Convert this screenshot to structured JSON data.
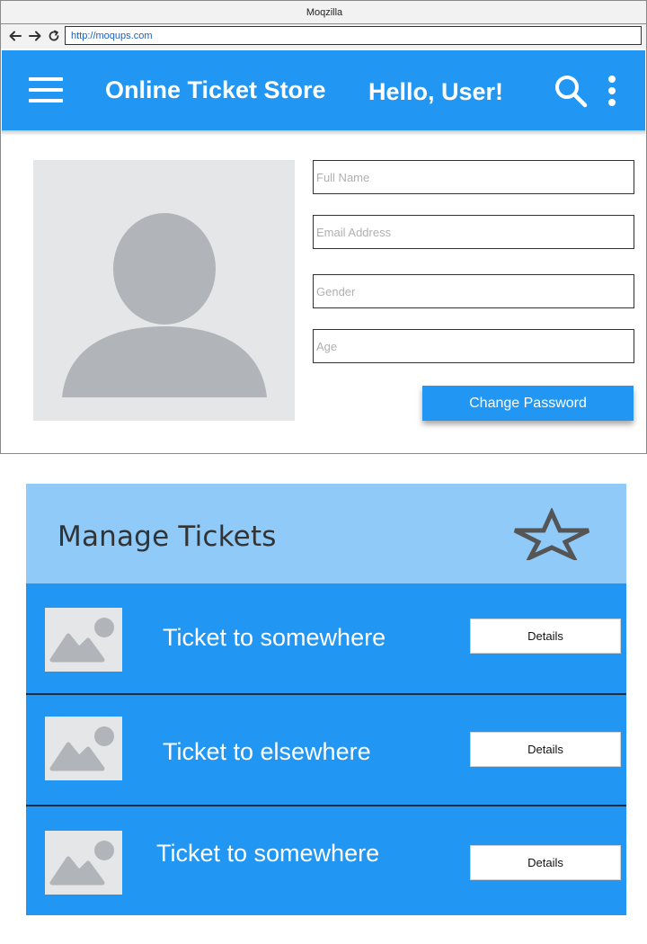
{
  "browser": {
    "window_title": "Moqzilla",
    "url": "http://moqups.com"
  },
  "header": {
    "app_title": "Online Ticket Store",
    "greeting": "Hello, User!"
  },
  "profile": {
    "fields": {
      "full_name_placeholder": "Full Name",
      "email_placeholder": "Email Address",
      "gender_placeholder": "Gender",
      "age_placeholder": "Age"
    },
    "change_password_label": "Change Password"
  },
  "tickets": {
    "title": "Manage Tickets",
    "items": [
      {
        "title": "Ticket to somewhere",
        "details_label": "Details"
      },
      {
        "title": "Ticket to elsewhere",
        "details_label": "Details"
      },
      {
        "title": "Ticket to somewhere",
        "details_label": "Details"
      }
    ]
  },
  "colors": {
    "primary": "#2196f3",
    "header_light": "#90caf9",
    "placeholder_bg": "#e5e6e7",
    "placeholder_fg": "#b1b5b9"
  },
  "icons": {
    "menu": "hamburger-icon",
    "search": "search-icon",
    "more": "kebab-icon",
    "favorite": "star-icon",
    "image": "image-placeholder-icon",
    "avatar": "user-avatar-icon"
  }
}
